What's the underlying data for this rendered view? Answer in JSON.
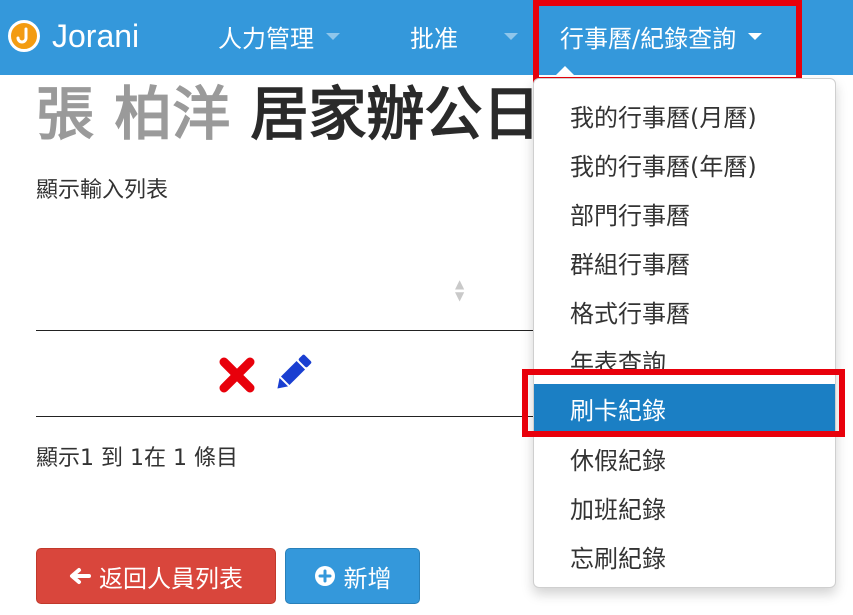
{
  "navbar": {
    "brand": "Jorani",
    "items": [
      {
        "label": "人力管理"
      },
      {
        "label": "批准"
      },
      {
        "label": "行事曆/紀錄查詢"
      }
    ]
  },
  "page": {
    "title_name": "張 柏洋",
    "title_type": "居家辦公日",
    "subtitle": "顯示輸入列表",
    "info": "顯示1 到 1在 1 條目"
  },
  "buttons": {
    "back": "返回人員列表",
    "add": "新增"
  },
  "dropdown": {
    "items": [
      {
        "label": "我的行事曆(月曆)"
      },
      {
        "label": "我的行事曆(年曆)"
      },
      {
        "label": "部門行事曆"
      },
      {
        "label": "群組行事曆"
      },
      {
        "label": "格式行事曆"
      },
      {
        "label": "年表查詢"
      },
      {
        "label": "刷卡紀錄"
      },
      {
        "label": "休假紀錄"
      },
      {
        "label": "加班紀錄"
      },
      {
        "label": "忘刷紀錄"
      }
    ],
    "active_index": 6
  },
  "colors": {
    "navbar": "#3498db",
    "highlight": "#e8000b",
    "active_item": "#1b7fc4",
    "delete_icon": "#e8000b",
    "edit_icon": "#1a3fd1",
    "back_button": "#d9463c",
    "add_button": "#3498db"
  },
  "icons": {
    "delete": "close-x-icon",
    "edit": "pencil-icon",
    "back": "arrow-left-icon",
    "add": "plus-circle-icon",
    "sort": "sort-icon",
    "brand": "jorani-logo-icon"
  }
}
